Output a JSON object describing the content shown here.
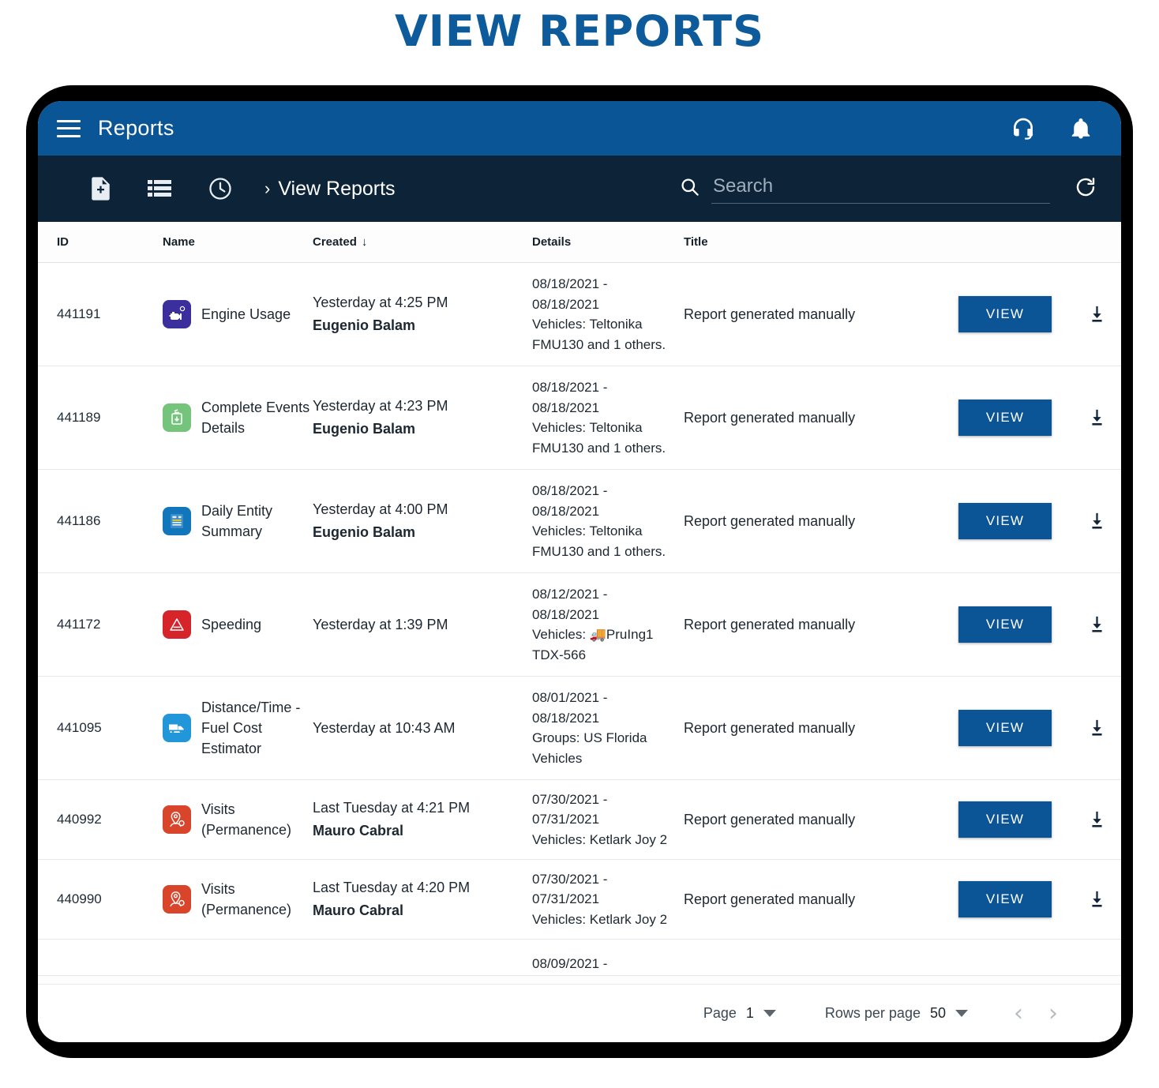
{
  "page": {
    "title": "VIEW REPORTS"
  },
  "appbar": {
    "title": "Reports",
    "menu_icon": "hamburger-icon",
    "support_icon": "headset-icon",
    "notifications_icon": "bell-icon"
  },
  "toolbar": {
    "new_report_icon": "file-plus-icon",
    "list_icon": "list-icon",
    "history_icon": "clock-icon",
    "breadcrumb_chevron": "›",
    "breadcrumb": "View Reports",
    "search_icon": "search-icon",
    "search_value": "",
    "search_placeholder": "Search",
    "refresh_icon": "refresh-icon"
  },
  "table": {
    "columns": [
      "ID",
      "Name",
      "Created",
      "Details",
      "Title"
    ],
    "sort_column": "Created",
    "sort_indicator": "↓",
    "view_label": "VIEW",
    "download_icon": "download-icon",
    "rows": [
      {
        "id": "441191",
        "name": "Engine Usage",
        "icon": "engine-icon",
        "icon_color": "#3B2F9E",
        "created_time": "Yesterday at 4:25 PM",
        "created_author": "Eugenio Balam",
        "details": "08/18/2021 - 08/18/2021 Vehicles: Teltonika FMU130 and 1 others.",
        "details_lines": [
          "08/18/2021 -",
          "08/18/2021",
          "Vehicles: Teltonika",
          "FMU130 and 1 others."
        ],
        "title": "Report generated manually"
      },
      {
        "id": "441189",
        "name": "Complete Events Details",
        "icon": "events-details-icon",
        "icon_color": "#74C47C",
        "created_time": "Yesterday at 4:23 PM",
        "created_author": "Eugenio Balam",
        "details": "08/18/2021 - 08/18/2021 Vehicles: Teltonika FMU130 and 1 others.",
        "details_lines": [
          "08/18/2021 -",
          "08/18/2021",
          "Vehicles: Teltonika",
          "FMU130 and 1 others."
        ],
        "title": "Report generated manually"
      },
      {
        "id": "441186",
        "name": "Daily Entity Summary",
        "icon": "summary-document-icon",
        "icon_color": "#1176BC",
        "created_time": "Yesterday at 4:00 PM",
        "created_author": "Eugenio Balam",
        "details": "08/18/2021 - 08/18/2021 Vehicles: Teltonika FMU130 and 1 others.",
        "details_lines": [
          "08/18/2021 -",
          "08/18/2021",
          "Vehicles: Teltonika",
          "FMU130 and 1 others."
        ],
        "title": "Report generated manually"
      },
      {
        "id": "441172",
        "name": "Speeding",
        "icon": "speeding-cone-icon",
        "icon_color": "#D6242B",
        "created_time": "Yesterday at 1:39 PM",
        "created_author": "",
        "details": "08/12/2021 - 08/18/2021 Vehicles: 🚚PruIng1 TDX-566",
        "details_lines": [
          "08/12/2021 -",
          "08/18/2021",
          "Vehicles: 🚚PruIng1",
          "TDX-566"
        ],
        "title": "Report generated manually"
      },
      {
        "id": "441095",
        "name": "Distance/Time - Fuel Cost Estimator",
        "icon": "truck-icon",
        "icon_color": "#2196D9",
        "created_time": "Yesterday at 10:43 AM",
        "created_author": "",
        "details": "08/01/2021 - 08/18/2021 Groups: US Florida Vehicles",
        "details_lines": [
          "08/01/2021 -",
          "08/18/2021",
          "Groups: US Florida",
          "Vehicles"
        ],
        "title": "Report generated manually"
      },
      {
        "id": "440992",
        "name": "Visits (Permanence)",
        "icon": "visits-pin-icon",
        "icon_color": "#D9452B",
        "created_time": "Last Tuesday at 4:21 PM",
        "created_author": "Mauro Cabral",
        "details": "07/30/2021 - 07/31/2021 Vehicles: Ketlark Joy 2",
        "details_lines": [
          "07/30/2021 -",
          "07/31/2021",
          "Vehicles: Ketlark Joy 2"
        ],
        "title": "Report generated manually"
      },
      {
        "id": "440990",
        "name": "Visits (Permanence)",
        "icon": "visits-pin-icon",
        "icon_color": "#D9452B",
        "created_time": "Last Tuesday at 4:20 PM",
        "created_author": "Mauro Cabral",
        "details": "07/30/2021 - 07/31/2021 Vehicles: Ketlark Joy 2",
        "details_lines": [
          "07/30/2021 -",
          "07/31/2021",
          "Vehicles: Ketlark Joy 2"
        ],
        "title": "Report generated manually"
      }
    ],
    "partial_row": {
      "details_lines": [
        "08/09/2021 -"
      ]
    }
  },
  "paginator": {
    "page_label": "Page",
    "page_value": "1",
    "rows_label": "Rows per page",
    "rows_value": "50",
    "prev_icon": "‹",
    "next_icon": "›"
  },
  "colors": {
    "brand_blue": "#0A5595",
    "dark_navy": "#0D2338",
    "title_blue": "#0E5B9C",
    "button_blue": "#0B5596"
  }
}
